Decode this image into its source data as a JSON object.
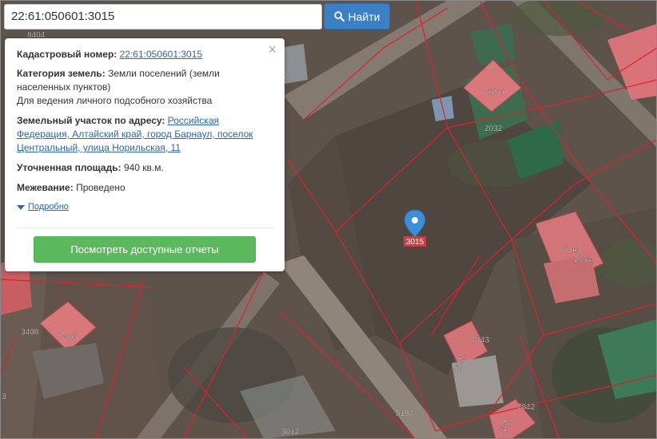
{
  "search": {
    "value": "22:61:050601:3015",
    "button_label": "Найти"
  },
  "popup": {
    "cadastral_label": "Кадастровый номер:",
    "cadastral_value": "22:61:050601:3015",
    "category_label": "Категория земель:",
    "category_value": "Земли поселений (земли",
    "category_value_line2": "населенных пунктов)",
    "use_value": "Для ведения личного подсобного хозяйства",
    "address_label": "Земельный участок по адресу:",
    "address_value": "Российская Федерация, Алтайский край, город Барнаул, поселок Центральный, улица Норильская, 11",
    "area_label": "Уточненная площадь:",
    "area_value": "940 кв.м.",
    "survey_label": "Межевание:",
    "survey_value": "Проведено",
    "more_link": "Подробно",
    "reports_button": "Посмотреть доступные отчеты",
    "close": "×"
  },
  "map_labels": {
    "selected_parcel": "3015",
    "p8404": "8404",
    "p6176": "6176",
    "p2032": "2032",
    "p8263": "8263",
    "p2034": "2034",
    "p7843": "7843",
    "p8122": "8122",
    "p7842": "7842",
    "p5194": "5194",
    "p3012": "3012",
    "p3408": "3408",
    "p7403": "7403",
    "p872": "872",
    "p3": "3",
    "p7": "7"
  },
  "colors": {
    "parcel_line": "#e0202a",
    "roof": "#d9787b",
    "selected_text": "#ffffff",
    "marker": "#3a8fd8"
  }
}
